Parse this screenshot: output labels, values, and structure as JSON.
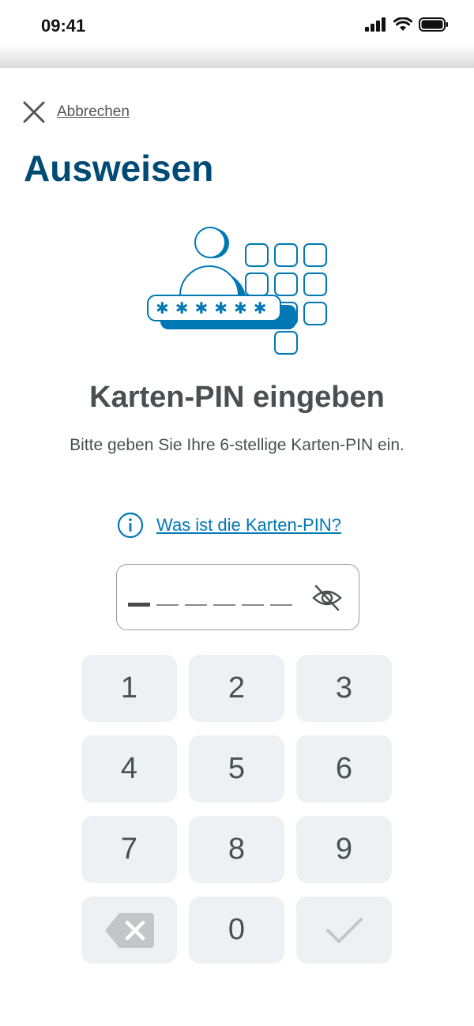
{
  "status_bar": {
    "time": "09:41",
    "icons": [
      "signal-icon",
      "wifi-icon",
      "battery-icon"
    ]
  },
  "header": {
    "cancel_label": "Abbrechen",
    "title": "Ausweisen"
  },
  "illustration": {
    "icon": "person-pin-keypad-illustration",
    "pin_mask": "✱✱✱✱✱✱"
  },
  "content": {
    "heading": "Karten-PIN eingeben",
    "subtext": "Bitte geben Sie Ihre 6-stellige Karten-PIN ein.",
    "info_link": "Was ist die Karten-PIN?"
  },
  "pin_input": {
    "length": 6,
    "filled": 0,
    "visibility_icon": "eye-off-icon"
  },
  "keypad": {
    "keys": [
      "1",
      "2",
      "3",
      "4",
      "5",
      "6",
      "7",
      "8",
      "9",
      "",
      "0",
      ""
    ],
    "delete_icon": "backspace-icon",
    "confirm_icon": "checkmark-icon"
  },
  "colors": {
    "title": "#004b76",
    "accent": "#0078b4",
    "text": "#4a4f52",
    "key_bg": "#eef1f3",
    "key_disabled": "#c3c6c8"
  }
}
